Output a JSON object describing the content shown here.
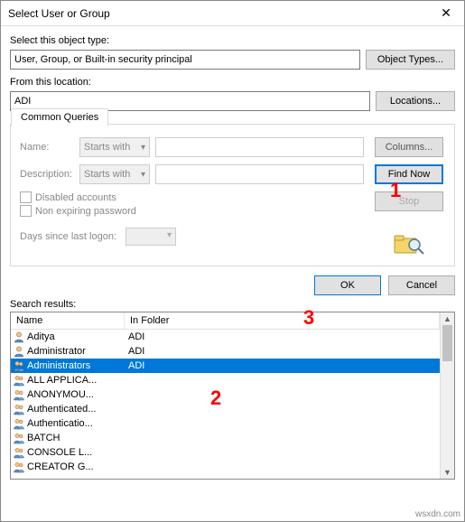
{
  "window": {
    "title": "Select User or Group"
  },
  "labels": {
    "object_type": "Select this object type:",
    "from_location": "From this location:",
    "search_results": "Search results:"
  },
  "fields": {
    "object_type": "User, Group, or Built-in security principal",
    "location": "ADI"
  },
  "buttons": {
    "object_types": "Object Types...",
    "locations": "Locations...",
    "columns": "Columns...",
    "find_now": "Find Now",
    "stop": "Stop",
    "ok": "OK",
    "cancel": "Cancel"
  },
  "tab": {
    "common_queries": "Common Queries"
  },
  "queries": {
    "name_label": "Name:",
    "name_match": "Starts with",
    "desc_label": "Description:",
    "desc_match": "Starts with",
    "disabled_accounts": "Disabled accounts",
    "non_expiring": "Non expiring password",
    "days_label": "Days since last logon:"
  },
  "table": {
    "headers": {
      "name": "Name",
      "folder": "In Folder"
    },
    "rows": [
      {
        "icon": "user",
        "name": "Aditya",
        "folder": "ADI",
        "selected": false
      },
      {
        "icon": "user",
        "name": "Administrator",
        "folder": "ADI",
        "selected": false
      },
      {
        "icon": "group",
        "name": "Administrators",
        "folder": "ADI",
        "selected": true
      },
      {
        "icon": "group",
        "name": "ALL APPLICA...",
        "folder": "",
        "selected": false
      },
      {
        "icon": "group",
        "name": "ANONYMOU...",
        "folder": "",
        "selected": false
      },
      {
        "icon": "group",
        "name": "Authenticated...",
        "folder": "",
        "selected": false
      },
      {
        "icon": "group",
        "name": "Authenticatio...",
        "folder": "",
        "selected": false
      },
      {
        "icon": "group",
        "name": "BATCH",
        "folder": "",
        "selected": false
      },
      {
        "icon": "group",
        "name": "CONSOLE L...",
        "folder": "",
        "selected": false
      },
      {
        "icon": "group",
        "name": "CREATOR G...",
        "folder": "",
        "selected": false
      }
    ]
  },
  "annotations": {
    "one": "1",
    "two": "2",
    "three": "3"
  },
  "watermark": "wsxdn.com"
}
